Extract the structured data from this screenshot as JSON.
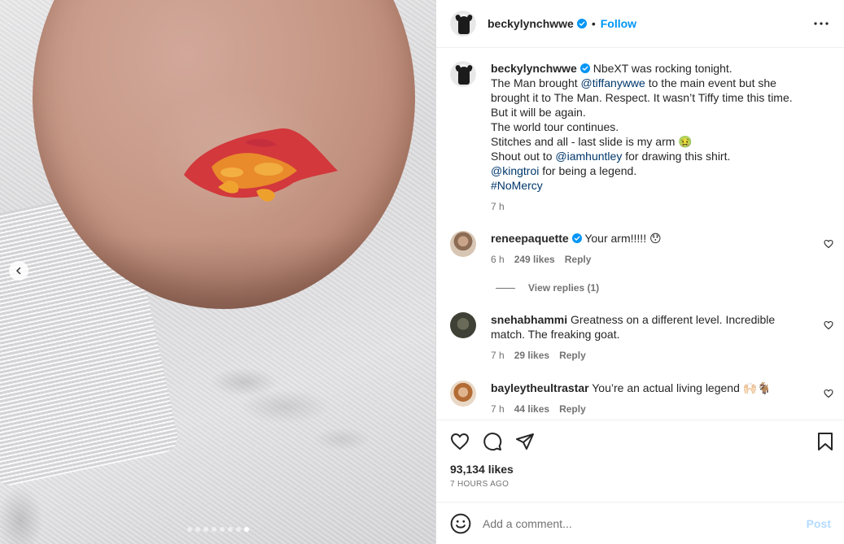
{
  "post": {
    "username": "beckylynchwwe",
    "follow_label": "Follow",
    "separator": "•",
    "caption_lines": [
      "NbeXT was rocking tonight.",
      "The Man brought ",
      "@tiffanywwe",
      " to the main event but she",
      "brought it to The Man. Respect. It wasn’t Tiffy time this time.",
      "But it will be again.",
      "The world tour continues.",
      "Stitches and all - last slide is my arm 🤢",
      "Shout out to ",
      "@iamhuntley",
      " for drawing this shirt.",
      "@kingtroi",
      " for being a legend.",
      "#NoMercy"
    ],
    "caption_time": "7 h",
    "carousel_dots": 8,
    "active_dot": 7
  },
  "comments": [
    {
      "username": "reneepaquette",
      "verified": true,
      "text": "Your arm!!!!! 😯",
      "time": "6 h",
      "likes": "249 likes",
      "reply": "Reply"
    },
    {
      "username": "snehabhammi",
      "verified": false,
      "text_line1": "Greatness on a different level. Incredible",
      "text_line2": "match. The freaking goat.",
      "time": "7 h",
      "likes": "29 likes",
      "reply": "Reply"
    },
    {
      "username": "bayleytheultrastar",
      "verified": false,
      "text": "You’re an actual living legend 🙌🏻🐐",
      "time": "7 h",
      "likes": "44 likes",
      "reply": "Reply"
    }
  ],
  "view_replies": "View replies (1)",
  "footer": {
    "likes": "93,134 likes",
    "time_ago": "7 HOURS AGO",
    "comment_placeholder": "Add a comment...",
    "post_label": "Post"
  },
  "icons": {
    "verified": "verified-badge-icon",
    "more": "more-options-icon",
    "like": "heart-icon",
    "comment": "comment-icon",
    "share": "share-icon",
    "save": "bookmark-icon",
    "emoji": "emoji-icon",
    "prev": "chevron-left-icon"
  },
  "colors": {
    "accent": "#0095f6",
    "link": "#00376b",
    "muted": "#737373",
    "post_disabled": "#b3dbff"
  }
}
